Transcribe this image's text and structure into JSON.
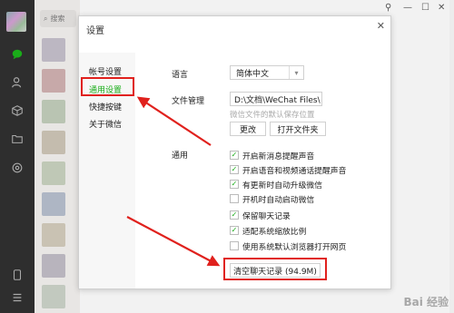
{
  "chat_list": {
    "search_placeholder": "搜索"
  },
  "window_controls": {
    "pin": "⚲",
    "minimize": "—",
    "maximize": "☐",
    "close": "✕"
  },
  "dialog": {
    "title": "设置",
    "close": "✕",
    "nav": [
      {
        "label": "帐号设置"
      },
      {
        "label": "通用设置"
      },
      {
        "label": "快捷按键"
      },
      {
        "label": "关于微信"
      }
    ],
    "language": {
      "label": "语言",
      "value": "简体中文"
    },
    "file_management": {
      "label": "文件管理",
      "path": "D:\\文档\\WeChat Files\\",
      "hint": "微信文件的默认保存位置",
      "change": "更改",
      "open_folder": "打开文件夹"
    },
    "general": {
      "label": "通用",
      "options": [
        {
          "label": "开启新消息提醒声音",
          "checked": true
        },
        {
          "label": "开启语音和视频通话提醒声音",
          "checked": true
        },
        {
          "label": "有更新时自动升级微信",
          "checked": true
        },
        {
          "label": "开机时自动启动微信",
          "checked": false
        },
        {
          "label": "保留聊天记录",
          "checked": true
        },
        {
          "label": "适配系统缩放比例",
          "checked": true
        },
        {
          "label": "使用系统默认浏览器打开网页",
          "checked": false
        }
      ]
    },
    "clear_history": "清空聊天记录 (94.9M)"
  },
  "annotation_color": "#e0211d",
  "watermark": "Bai 经验"
}
